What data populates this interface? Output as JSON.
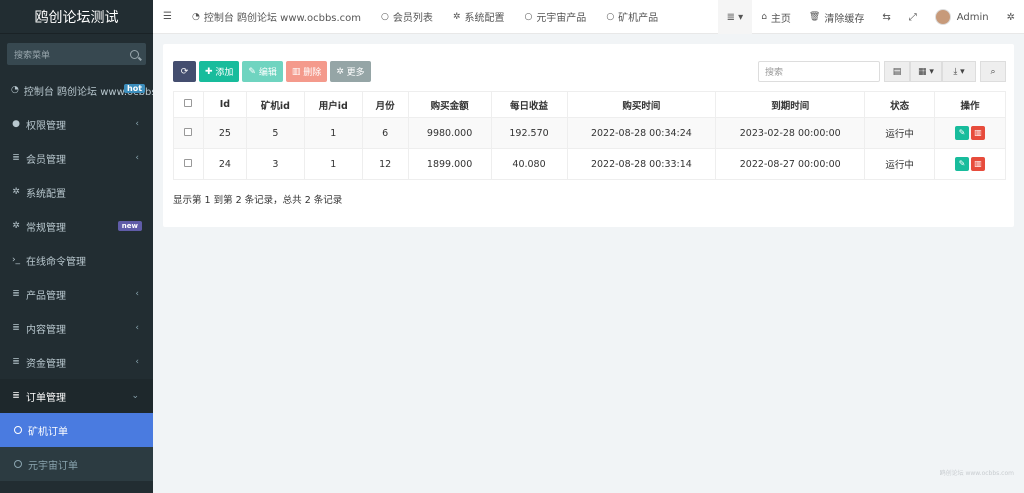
{
  "sidebar": {
    "brand": "鸥创论坛测试",
    "search_placeholder": "搜索菜单",
    "items": [
      {
        "label": "控制台 鸥创论坛 www.ocbbs.com",
        "icon": "dashboard-icon",
        "badge": "hot"
      },
      {
        "label": "权限管理",
        "icon": "users-icon"
      },
      {
        "label": "会员管理",
        "icon": "list-icon"
      },
      {
        "label": "系统配置",
        "icon": "gear-icon"
      },
      {
        "label": "常规管理",
        "icon": "cogs-icon",
        "badge": "new"
      },
      {
        "label": "在线命令管理",
        "icon": "terminal-icon"
      },
      {
        "label": "产品管理",
        "icon": "list-icon"
      },
      {
        "label": "内容管理",
        "icon": "list-icon"
      },
      {
        "label": "资金管理",
        "icon": "list-icon"
      },
      {
        "label": "订单管理",
        "icon": "list-icon"
      }
    ],
    "sub_items": [
      {
        "label": "矿机订单",
        "active": true
      },
      {
        "label": "元宇宙订单",
        "active": false
      }
    ]
  },
  "topnav": {
    "tabs": [
      {
        "label": "控制台 鸥创论坛 www.ocbbs.com",
        "icon": "dashboard-icon"
      },
      {
        "label": "会员列表",
        "icon": "circle-icon"
      },
      {
        "label": "系统配置",
        "icon": "gear-icon"
      },
      {
        "label": "元宇宙产品",
        "icon": "circle-icon"
      },
      {
        "label": "矿机产品",
        "icon": "circle-icon"
      }
    ],
    "home_label": "主页",
    "clear_cache_label": "清除缓存",
    "user_name": "Admin"
  },
  "toolbar": {
    "add_label": "添加",
    "edit_label": "编辑",
    "delete_label": "删除",
    "more_label": "更多",
    "search_placeholder": "搜索"
  },
  "table": {
    "headers": [
      "Id",
      "矿机id",
      "用户id",
      "月份",
      "购买金额",
      "每日收益",
      "购买时间",
      "到期时间",
      "状态",
      "操作"
    ],
    "rows": [
      [
        "25",
        "5",
        "1",
        "6",
        "9980.000",
        "192.570",
        "2022-08-28 00:34:24",
        "2023-02-28 00:00:00",
        "运行中"
      ],
      [
        "24",
        "3",
        "1",
        "12",
        "1899.000",
        "40.080",
        "2022-08-28 00:33:14",
        "2022-08-27 00:00:00",
        "运行中"
      ]
    ]
  },
  "pagination_info": "显示第 1 到第 2 条记录，总共 2 条记录",
  "watermark": "鸥创论坛 www.ocbbs.com",
  "colors": {
    "sidebar_bg": "#222d32",
    "active_menu": "#4a7be0",
    "success": "#18bc9c",
    "danger": "#e74c3c"
  }
}
